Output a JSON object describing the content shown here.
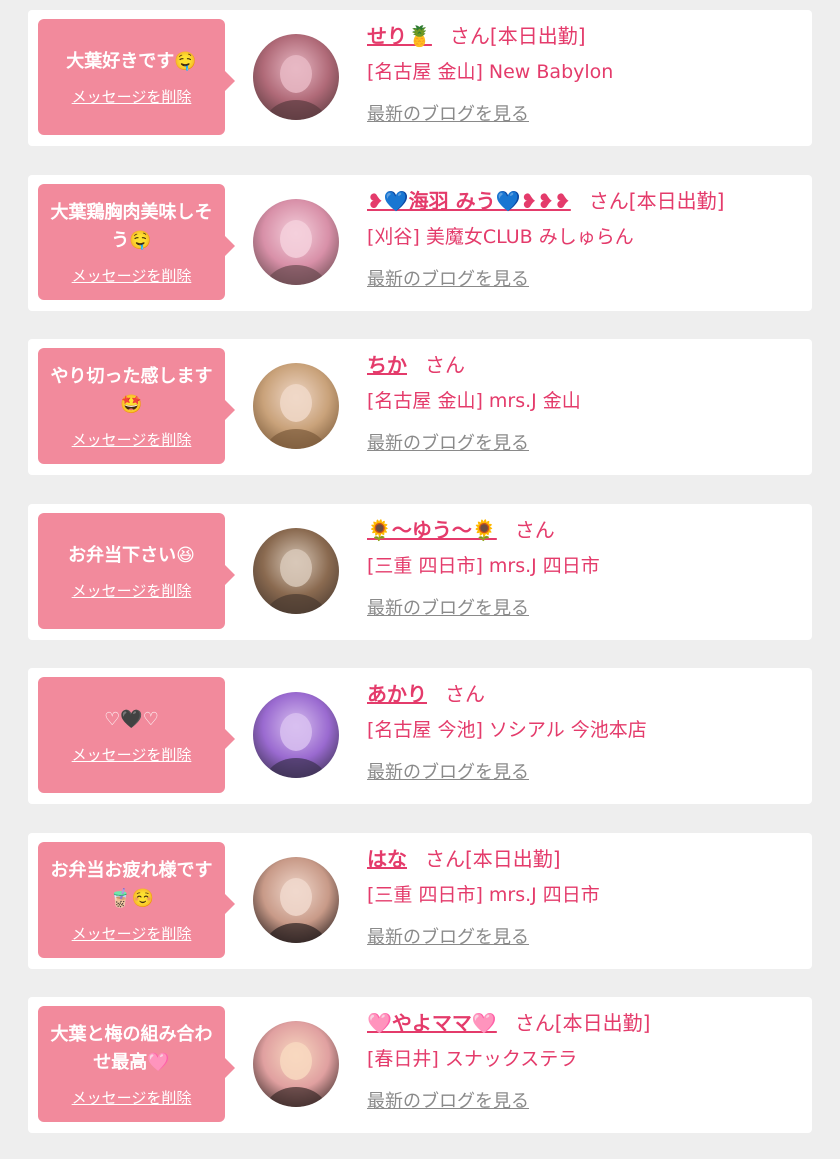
{
  "colors": {
    "background": "#eeeeee",
    "card": "#ffffff",
    "bubble": "#f28a9c",
    "accent": "#e43b6b",
    "link_gray": "#8a8a8a"
  },
  "cards": [
    {
      "message": "大葉好きです🤤",
      "delete_label": "メッセージを削除",
      "name": "せり🍍",
      "san": "さん[本日出勤]",
      "shop": "[名古屋 金山] New Babylon",
      "blog_label": "最新のブログを見る",
      "avatar_colors": [
        "#5a3a3e",
        "#b06a78",
        "#e8b8c4"
      ]
    },
    {
      "message": "大葉鶏胸肉美味しそう🤤",
      "delete_label": "メッセージを削除",
      "name": "❥💙海羽 みう💙❥❥❥",
      "san": "さん[本日出勤]",
      "shop": "[刈谷] 美魔女CLUB みしゅらん",
      "blog_label": "最新のブログを見る",
      "avatar_colors": [
        "#6a4a50",
        "#d890a8",
        "#f4d0dc"
      ]
    },
    {
      "message": "やり切った感します🤩",
      "delete_label": "メッセージを削除",
      "name": "ちか",
      "san": "さん",
      "shop": "[名古屋 金山] mrs.J 金山",
      "blog_label": "最新のブログを見る",
      "avatar_colors": [
        "#7a5a3a",
        "#c9a27a",
        "#f0d8c8"
      ]
    },
    {
      "message": "お弁当下さい😆",
      "delete_label": "メッセージを削除",
      "name": "🌻〜ゆう〜🌻",
      "san": "さん",
      "shop": "[三重 四日市] mrs.J 四日市",
      "blog_label": "最新のブログを見る",
      "avatar_colors": [
        "#4a3a30",
        "#8a6a50",
        "#d8c8b8"
      ]
    },
    {
      "message": "♡🖤♡",
      "delete_label": "メッセージを削除",
      "name": "あかり",
      "san": "さん",
      "shop": "[名古屋 今池] ソシアル 今池本店",
      "blog_label": "最新のブログを見る",
      "avatar_colors": [
        "#3a3050",
        "#9a6ad0",
        "#d8c0f0"
      ]
    },
    {
      "message": "お弁当お疲れ様です🧋☺️",
      "delete_label": "メッセージを削除",
      "name": "はな",
      "san": "さん[本日出勤]",
      "shop": "[三重 四日市] mrs.J 四日市",
      "blog_label": "最新のブログを見る",
      "avatar_colors": [
        "#2a2020",
        "#c89a88",
        "#f0d8cc"
      ]
    },
    {
      "message": "大葉と梅の組み合わせ最高🩷",
      "delete_label": "メッセージを削除",
      "name": "🩷やよママ🩷",
      "san": "さん[本日出勤]",
      "shop": "[春日井] スナックステラ",
      "blog_label": "最新のブログを見る",
      "avatar_colors": [
        "#3a2a28",
        "#e0a0a0",
        "#f8d8c0"
      ]
    }
  ]
}
